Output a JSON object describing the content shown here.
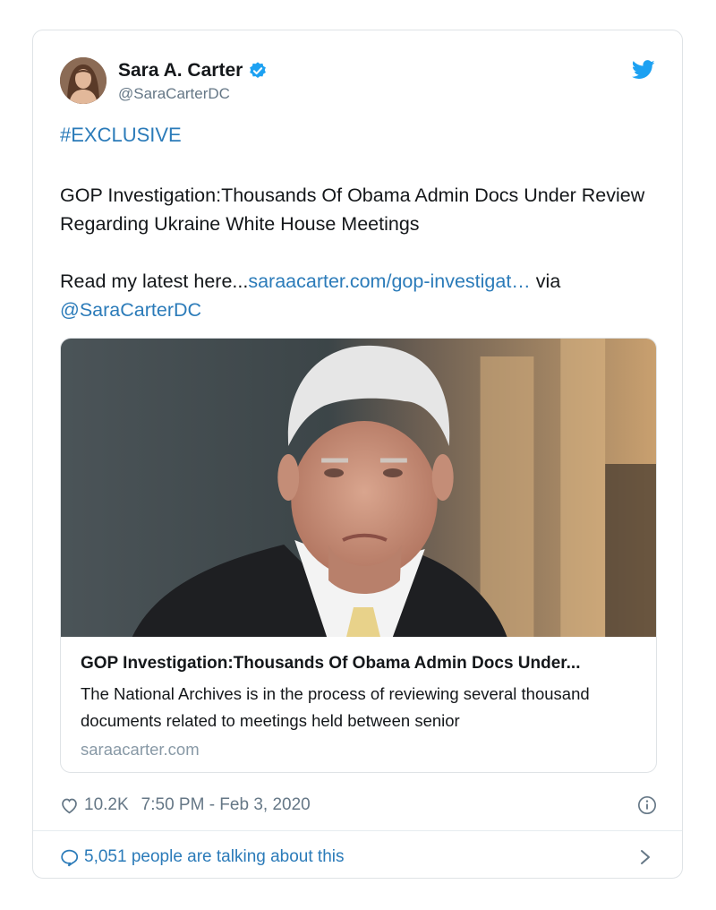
{
  "author": {
    "name": "Sara A. Carter",
    "handle": "@SaraCarterDC",
    "verified": true
  },
  "tweet": {
    "hashtag": "#EXCLUSIVE",
    "line1": "GOP Investigation:Thousands Of Obama Admin Docs Under Review Regarding Ukraine White House Meetings",
    "read_prefix": "Read my latest here...",
    "link": "saraacarter.com/gop-investigat…",
    "via": " via",
    "mention": "@SaraCarterDC"
  },
  "preview": {
    "title": "GOP Investigation:Thousands Of Obama Admin Docs Under...",
    "description": "The National Archives is in the process of reviewing several thousand documents related to meetings held between senior",
    "domain": "saraacarter.com"
  },
  "stats": {
    "likes": "10.2K",
    "timestamp": "7:50 PM - Feb 3, 2020"
  },
  "conversation": {
    "label": "5,051 people are talking about this"
  },
  "colors": {
    "link": "#2b7bb9",
    "verified": "#1da1f2",
    "secondary_text": "#657786"
  },
  "icons": [
    "verified-badge-icon",
    "twitter-bird-icon",
    "heart-icon",
    "info-icon",
    "speech-bubble-icon",
    "chevron-right-icon"
  ]
}
